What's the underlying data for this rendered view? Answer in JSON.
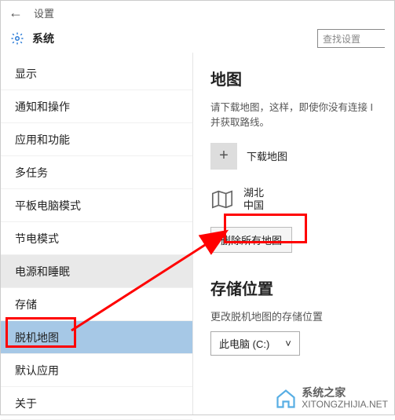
{
  "header": {
    "title": "设置"
  },
  "subheader": {
    "title": "系统",
    "search_placeholder": "查找设置"
  },
  "sidebar": {
    "items": [
      {
        "label": "显示"
      },
      {
        "label": "通知和操作"
      },
      {
        "label": "应用和功能"
      },
      {
        "label": "多任务"
      },
      {
        "label": "平板电脑模式"
      },
      {
        "label": "节电模式"
      },
      {
        "label": "电源和睡眠"
      },
      {
        "label": "存储"
      },
      {
        "label": "脱机地图"
      },
      {
        "label": "默认应用"
      },
      {
        "label": "关于"
      }
    ]
  },
  "main": {
    "maps_heading": "地图",
    "maps_desc_line1": "请下载地图，这样，即使你没有连接 I",
    "maps_desc_line2": "并获取路线。",
    "download_label": "下载地图",
    "region_name": "湖北",
    "region_country": "中国",
    "delete_all_label": "删除所有地图",
    "storage_heading": "存储位置",
    "storage_desc": "更改脱机地图的存储位置",
    "storage_select": "此电脑 (C:)"
  },
  "watermark": {
    "brand": "系统之家",
    "url": "XITONGZHIJIA.NET"
  }
}
